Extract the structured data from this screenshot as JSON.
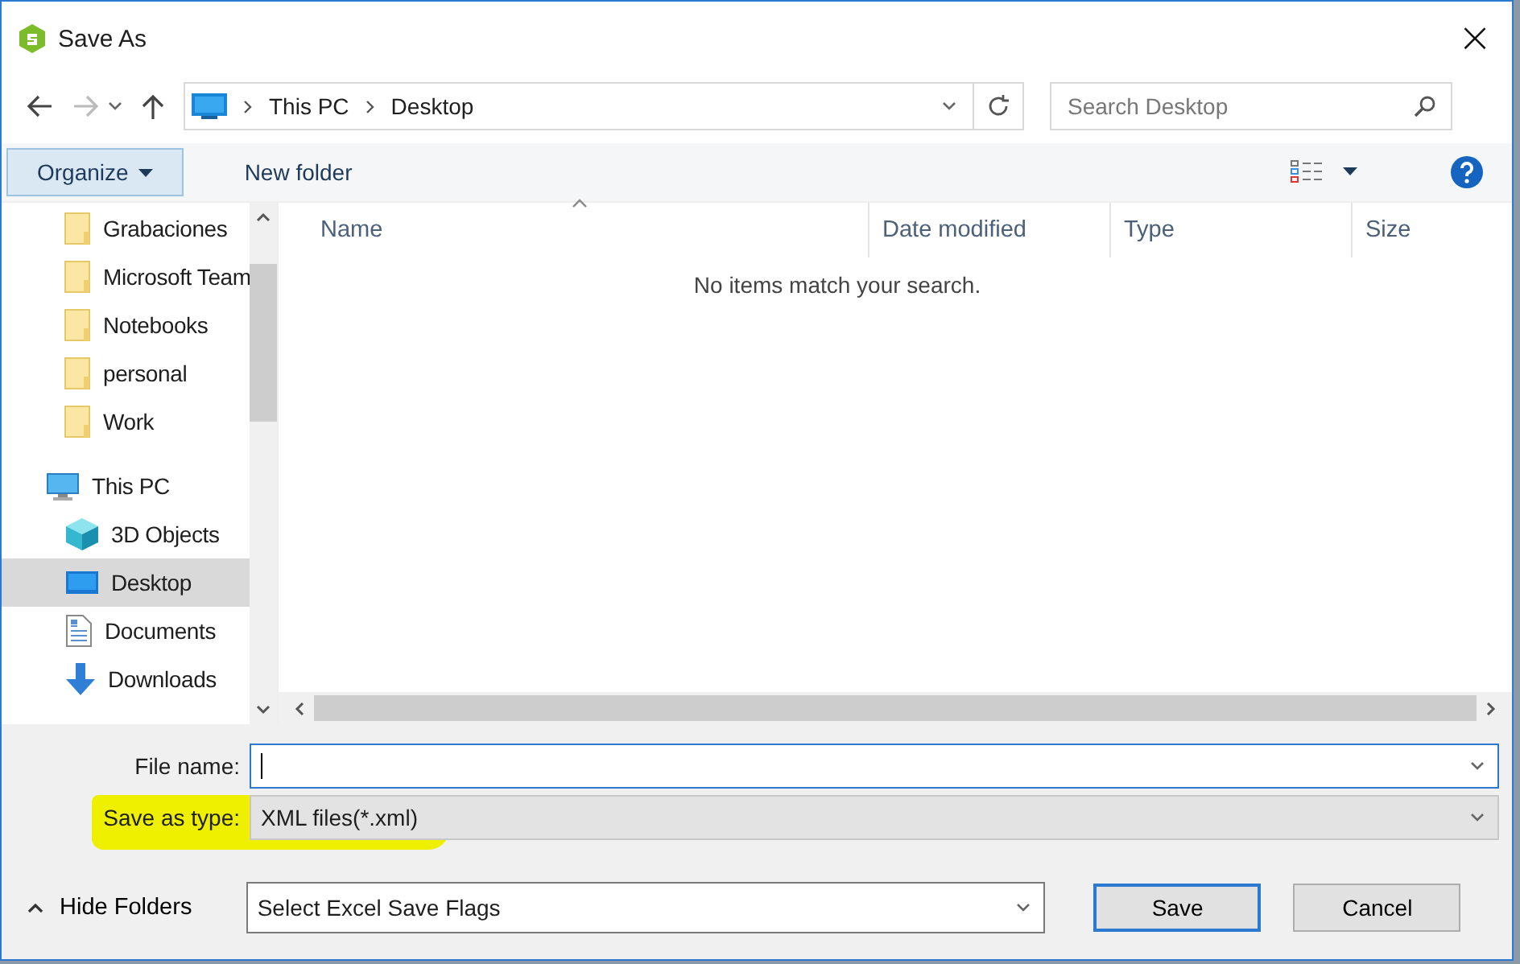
{
  "window": {
    "title": "Save As",
    "close": "×"
  },
  "address": {
    "path": [
      {
        "label": "This PC"
      },
      {
        "label": "Desktop"
      }
    ],
    "search_placeholder": "Search Desktop"
  },
  "toolbar": {
    "organize": "Organize",
    "new_folder": "New folder"
  },
  "sidebar": {
    "items": [
      {
        "label": "Grabaciones",
        "kind": "folder",
        "selected": false
      },
      {
        "label": "Microsoft Team",
        "kind": "folder",
        "selected": false
      },
      {
        "label": "Notebooks",
        "kind": "folder",
        "selected": false
      },
      {
        "label": "personal",
        "kind": "folder",
        "selected": false
      },
      {
        "label": "Work",
        "kind": "folder",
        "selected": false
      },
      {
        "label": "This PC",
        "kind": "pc",
        "selected": false,
        "children": [
          {
            "label": "3D Objects",
            "kind": "cube",
            "selected": false
          },
          {
            "label": "Desktop",
            "kind": "desktop",
            "selected": true
          },
          {
            "label": "Documents",
            "kind": "document",
            "selected": false
          },
          {
            "label": "Downloads",
            "kind": "download",
            "selected": false
          }
        ]
      }
    ]
  },
  "file_list": {
    "columns": [
      {
        "label": "Name",
        "sorted": true
      },
      {
        "label": "Date modified",
        "sorted": false
      },
      {
        "label": "Type",
        "sorted": false
      },
      {
        "label": "Size",
        "sorted": false
      }
    ],
    "empty_message": "No items match your search."
  },
  "form": {
    "file_name_label": "File name:",
    "save_type_label": "Save as type:",
    "save_type_value": "XML files(*.xml)",
    "highlighted": true
  },
  "footer": {
    "hide_folders": "Hide Folders",
    "flags_value": "Select Excel Save Flags",
    "buttons": [
      {
        "label": "Save",
        "default": true
      },
      {
        "label": "Cancel",
        "default": false
      }
    ]
  }
}
